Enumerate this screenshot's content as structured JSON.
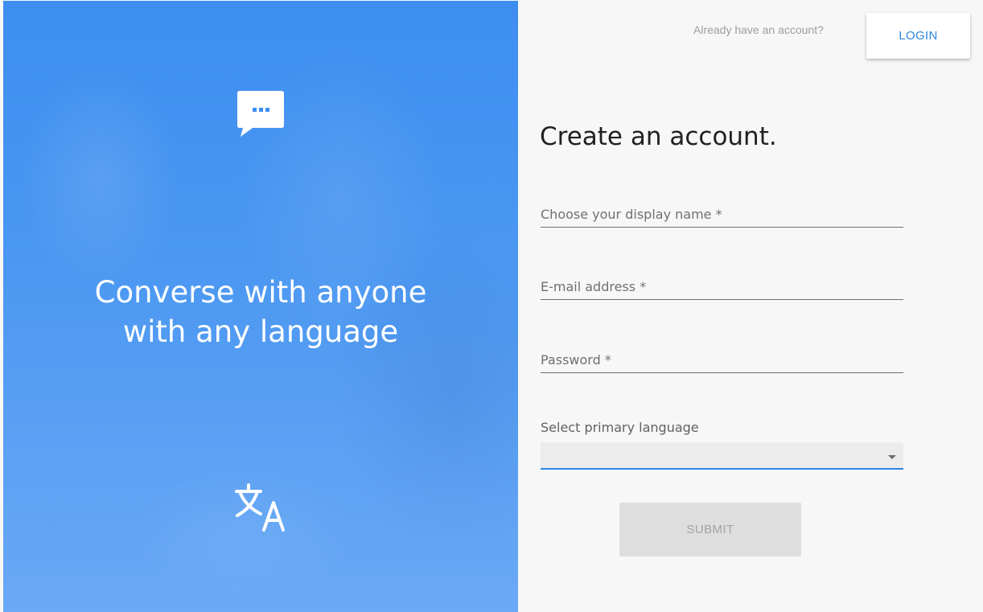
{
  "hero": {
    "title_line1": "Converse with anyone",
    "title_line2": "with any language",
    "icons": [
      "chat-bubble-icon",
      "translate-icon"
    ],
    "background_color": "#4a96f2"
  },
  "header": {
    "already_text": "Already have an account?",
    "login_label": "LOGIN"
  },
  "form": {
    "title": "Create an account.",
    "display_name_label": "Choose your display name *",
    "email_label": "E-mail address *",
    "password_label": "Password *",
    "language_label": "Select primary language",
    "language_value": "",
    "submit_label": "SUBMIT"
  },
  "colors": {
    "accent": "#2b86e0",
    "submit_disabled_bg": "#dedede",
    "page_bg": "#f7f7f7"
  }
}
